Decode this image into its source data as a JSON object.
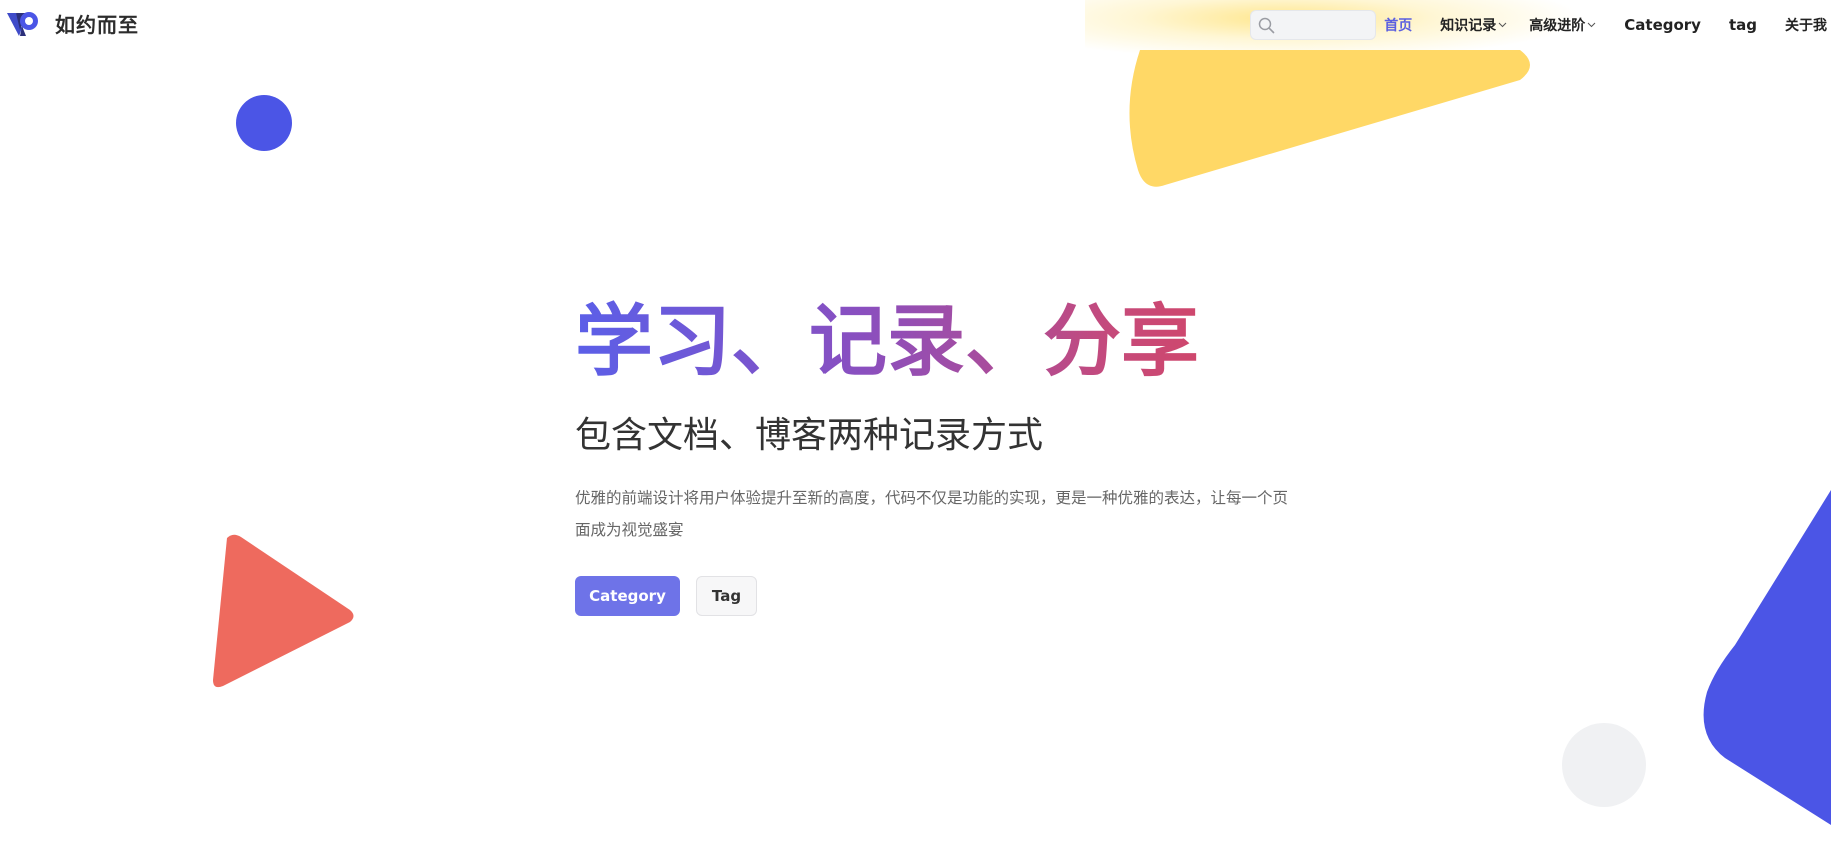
{
  "site": {
    "name": "如约而至",
    "logo_icon": "vp-logo-icon"
  },
  "search": {
    "placeholder": "",
    "icon": "search-icon"
  },
  "nav": {
    "items": [
      {
        "label": "首页",
        "active": true
      },
      {
        "label": "知识记录",
        "dropdown": true
      },
      {
        "label": "高级进阶",
        "dropdown": true
      },
      {
        "label": "Category"
      },
      {
        "label": "tag"
      },
      {
        "label": "关于我"
      }
    ]
  },
  "hero": {
    "title": "学习、记录、分享",
    "subtitle": "包含文档、博客两种记录方式",
    "description": "优雅的前端设计将用户体验提升至新的高度，代码不仅是功能的实现，更是一种优雅的表达，让每一个页面成为视觉盛宴",
    "buttons": {
      "primary": "Category",
      "secondary": "Tag"
    }
  },
  "colors": {
    "accent": "#6e73e8",
    "title_gradient_start": "#5b5fe8",
    "title_gradient_end": "#d9435d",
    "yellow_shape": "#ffd866",
    "blue_shape": "#4b55e6",
    "red_shape": "#ee6a5e",
    "grey_shape": "#f0f1f3"
  }
}
